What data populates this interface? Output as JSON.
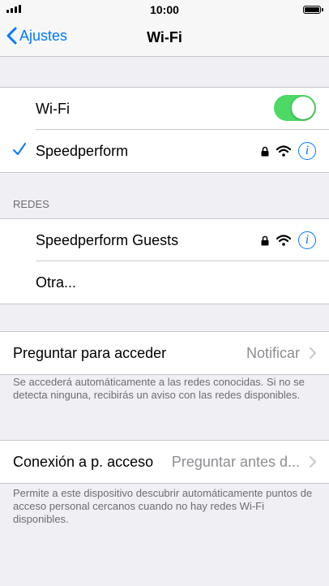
{
  "status": {
    "time": "10:00"
  },
  "nav": {
    "back_label": "Ajustes",
    "title": "Wi-Fi"
  },
  "wifi": {
    "toggle_label": "Wi-Fi",
    "toggle_on": true,
    "connected": "Speedperform"
  },
  "networks": {
    "header": "REDES",
    "items": [
      "Speedperform Guests"
    ],
    "other_label": "Otra..."
  },
  "ask": {
    "label": "Preguntar para acceder",
    "value": "Notificar",
    "footer": "Se accederá automáticamente a las redes conocidas. Si no se detecta ninguna, recibirás un aviso con las redes disponibles."
  },
  "hotspot": {
    "label": "Conexión a p. acceso",
    "value": "Preguntar antes d...",
    "footer": "Permite a este dispositivo descubrir automáticamente puntos de acceso personal cercanos cuando no hay redes Wi-Fi disponibles."
  },
  "colors": {
    "accent": "#007aff",
    "toggle_on": "#4cd964",
    "background": "#efeff4"
  }
}
